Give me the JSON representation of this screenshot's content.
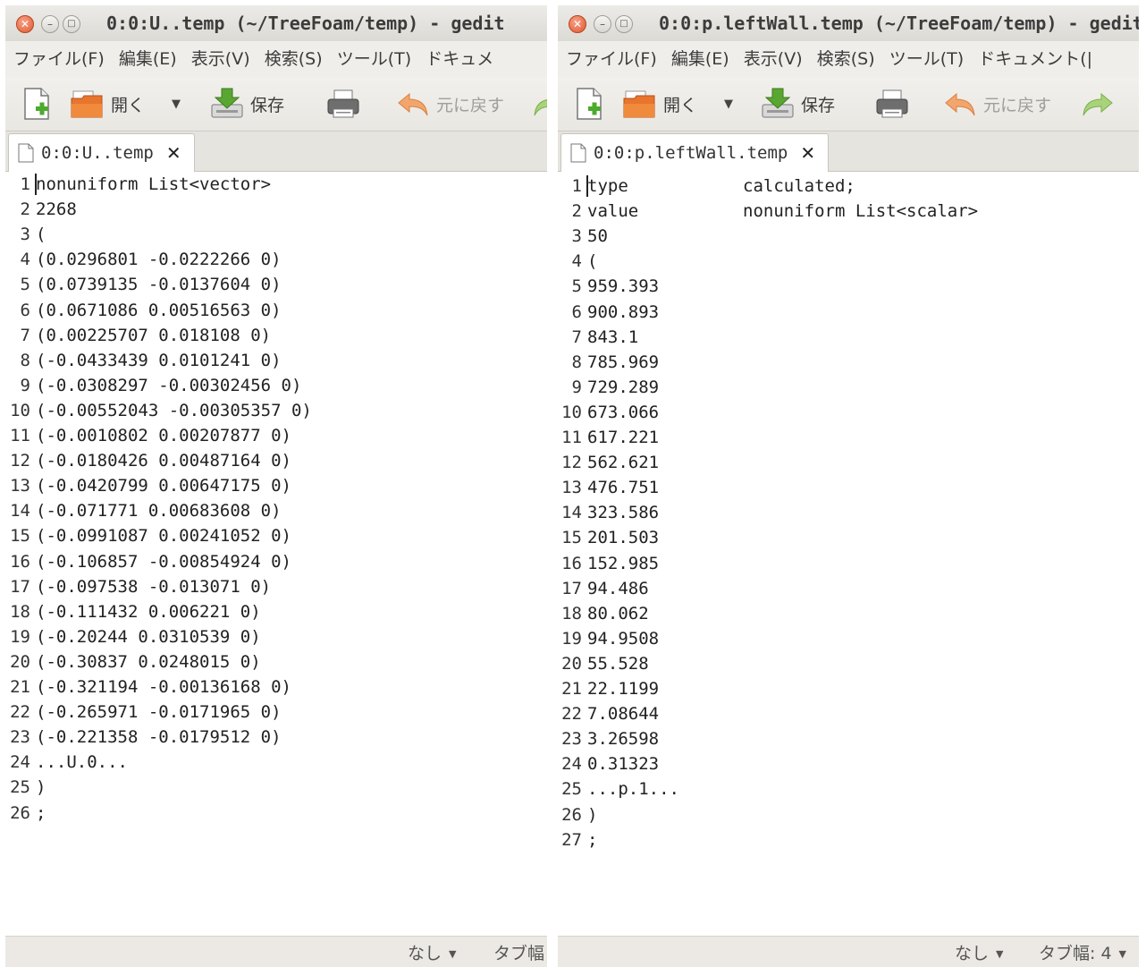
{
  "left": {
    "title": "0:0:U..temp (~/TreeFoam/temp) - gedit",
    "menu": [
      "ファイル(F)",
      "編集(E)",
      "表示(V)",
      "検索(S)",
      "ツール(T)",
      "ドキュメ"
    ],
    "toolbar": {
      "open": "開く",
      "save": "保存",
      "undo": "元に戻す"
    },
    "tab": "0:0:U..temp",
    "lines": [
      {
        "n": "1",
        "t": "nonuniform List<vector>"
      },
      {
        "n": "2",
        "t": "2268"
      },
      {
        "n": "3",
        "t": "("
      },
      {
        "n": "4",
        "t": "(0.0296801 -0.0222266 0)"
      },
      {
        "n": "5",
        "t": "(0.0739135 -0.0137604 0)"
      },
      {
        "n": "6",
        "t": "(0.0671086 0.00516563 0)"
      },
      {
        "n": "7",
        "t": "(0.00225707 0.018108 0)"
      },
      {
        "n": "8",
        "t": "(-0.0433439 0.0101241 0)"
      },
      {
        "n": "9",
        "t": "(-0.0308297 -0.00302456 0)"
      },
      {
        "n": "10",
        "t": "(-0.00552043 -0.00305357 0)"
      },
      {
        "n": "11",
        "t": "(-0.0010802 0.00207877 0)"
      },
      {
        "n": "12",
        "t": "(-0.0180426 0.00487164 0)"
      },
      {
        "n": "13",
        "t": "(-0.0420799 0.00647175 0)"
      },
      {
        "n": "14",
        "t": "(-0.071771 0.00683608 0)"
      },
      {
        "n": "15",
        "t": "(-0.0991087 0.00241052 0)"
      },
      {
        "n": "16",
        "t": "(-0.106857 -0.00854924 0)"
      },
      {
        "n": "17",
        "t": "(-0.097538 -0.013071 0)"
      },
      {
        "n": "18",
        "t": "(-0.111432 0.006221 0)"
      },
      {
        "n": "19",
        "t": "(-0.20244 0.0310539 0)"
      },
      {
        "n": "20",
        "t": "(-0.30837 0.0248015 0)"
      },
      {
        "n": "21",
        "t": "(-0.321194 -0.00136168 0)"
      },
      {
        "n": "22",
        "t": "(-0.265971 -0.0171965 0)"
      },
      {
        "n": "23",
        "t": "(-0.221358 -0.0179512 0)"
      },
      {
        "n": "24",
        "t": "...U.0..."
      },
      {
        "n": "25",
        "t": ")"
      },
      {
        "n": "26",
        "t": ";"
      }
    ],
    "status": {
      "lang": "なし",
      "tab": "タブ幅"
    }
  },
  "right": {
    "title": "0:0:p.leftWall.temp (~/TreeFoam/temp) - gedit",
    "menu": [
      "ファイル(F)",
      "編集(E)",
      "表示(V)",
      "検索(S)",
      "ツール(T)",
      "ドキュメント(|"
    ],
    "toolbar": {
      "open": "開く",
      "save": "保存",
      "undo": "元に戻す"
    },
    "tab": "0:0:p.leftWall.temp",
    "lines": [
      {
        "n": "1",
        "t": "type",
        "t2": "calculated;"
      },
      {
        "n": "2",
        "t": "value",
        "t2": "nonuniform List<scalar>"
      },
      {
        "n": "3",
        "t": "50"
      },
      {
        "n": "4",
        "t": "("
      },
      {
        "n": "5",
        "t": "959.393"
      },
      {
        "n": "6",
        "t": "900.893"
      },
      {
        "n": "7",
        "t": "843.1"
      },
      {
        "n": "8",
        "t": "785.969"
      },
      {
        "n": "9",
        "t": "729.289"
      },
      {
        "n": "10",
        "t": "673.066"
      },
      {
        "n": "11",
        "t": "617.221"
      },
      {
        "n": "12",
        "t": "562.621"
      },
      {
        "n": "13",
        "t": "476.751"
      },
      {
        "n": "14",
        "t": "323.586"
      },
      {
        "n": "15",
        "t": "201.503"
      },
      {
        "n": "16",
        "t": "152.985"
      },
      {
        "n": "17",
        "t": "94.486"
      },
      {
        "n": "18",
        "t": "80.062"
      },
      {
        "n": "19",
        "t": "94.9508"
      },
      {
        "n": "20",
        "t": "55.528"
      },
      {
        "n": "21",
        "t": "22.1199"
      },
      {
        "n": "22",
        "t": "7.08644"
      },
      {
        "n": "23",
        "t": "3.26598"
      },
      {
        "n": "24",
        "t": "0.31323"
      },
      {
        "n": "25",
        "t": "...p.1..."
      },
      {
        "n": "26",
        "t": ")"
      },
      {
        "n": "27",
        "t": ";"
      }
    ],
    "status": {
      "lang": "なし",
      "tab": "タブ幅: 4"
    }
  }
}
